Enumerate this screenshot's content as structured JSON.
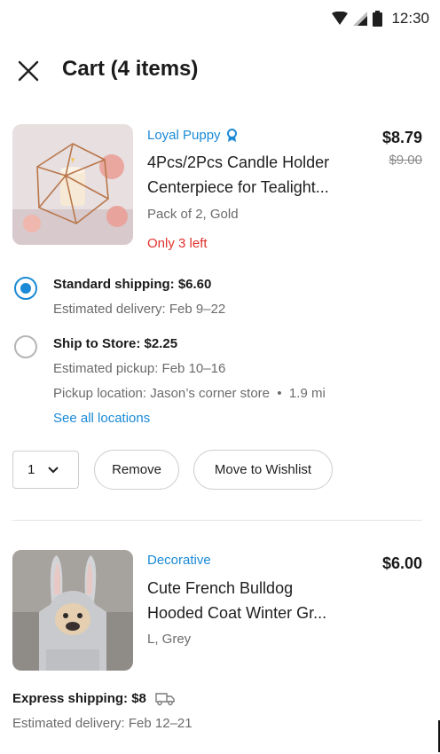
{
  "status_bar": {
    "time": "12:30"
  },
  "header": {
    "title": "Cart (4 items)"
  },
  "items": [
    {
      "store": "Loyal Puppy",
      "title_line1": "4Pcs/2Pcs Candle Holder",
      "title_line2": "Centerpiece for Tealight...",
      "variant": "Pack of 2, Gold",
      "stock": "Only 3 left",
      "price": "$8.79",
      "original_price": "$9.00",
      "shipping": [
        {
          "title": "Standard shipping: $6.60",
          "details": [
            "Estimated delivery: Feb 9–22"
          ],
          "selected": true
        },
        {
          "title": "Ship to Store: $2.25",
          "details": [
            "Estimated pickup: Feb 10–16",
            "Pickup location: Jason’s corner store  •  1.9 mi"
          ],
          "selected": false
        }
      ],
      "see_all_locations": "See all locations",
      "quantity": "1",
      "remove_label": "Remove",
      "wishlist_label": "Move to Wishlist"
    },
    {
      "store": "Decorative",
      "title_line1": "Cute French Bulldog",
      "title_line2": "Hooded Coat Winter Gr...",
      "variant": "L, Grey",
      "price": "$6.00",
      "shipping_title": "Express shipping: $8",
      "shipping_detail": "Estimated delivery: Feb 12–21"
    }
  ],
  "colors": {
    "accent": "#1a8ad6",
    "warning": "#e0322b",
    "muted": "#6b6b6b"
  },
  "icons": [
    "wifi-icon",
    "cellular-signal-icon",
    "battery-icon",
    "close-icon",
    "badge-icon",
    "chevron-down-icon",
    "delivery-truck-icon"
  ]
}
